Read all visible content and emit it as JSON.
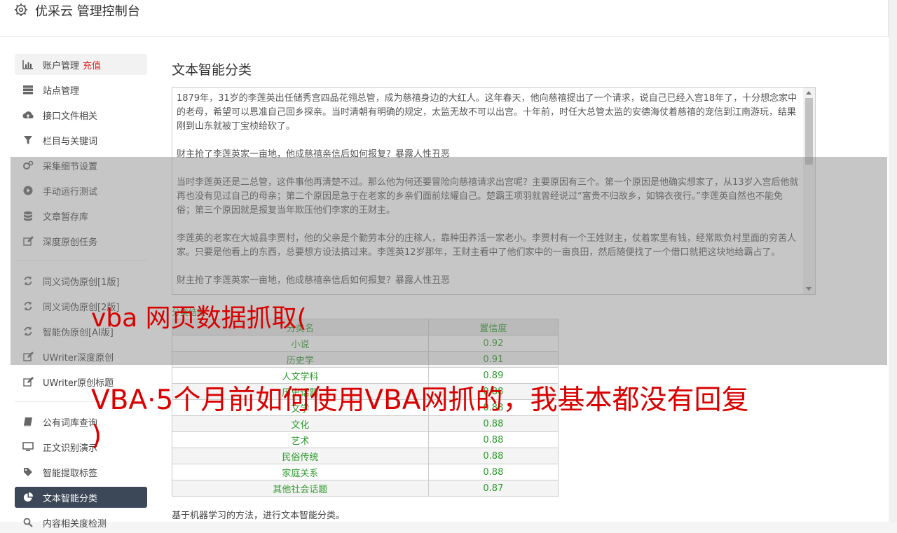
{
  "header": {
    "title": "优采云 管理控制台",
    "icon": "gear-icon"
  },
  "sidebar": {
    "items": [
      {
        "label": "账户管理",
        "badge": "充值",
        "icon": "bar-chart-icon"
      },
      {
        "label": "站点管理",
        "icon": "server-icon"
      },
      {
        "label": "接口文件相关",
        "icon": "cloud-upload-icon"
      },
      {
        "label": "栏目与关键词",
        "icon": "filter-icon"
      },
      {
        "label": "采集细节设置",
        "icon": "cogs-icon"
      },
      {
        "label": "手动运行测试",
        "icon": "play-circle-icon"
      },
      {
        "label": "文章暂存库",
        "icon": "database-icon"
      },
      {
        "label": "深度原创任务",
        "icon": "edit-icon"
      },
      {
        "label": "同义词伪原创[1版]",
        "icon": "refresh-icon"
      },
      {
        "label": "同义词伪原创[2版]",
        "icon": "refresh-icon"
      },
      {
        "label": "智能伪原创[AI版]",
        "icon": "refresh-icon"
      },
      {
        "label": "UWriter深度原创",
        "icon": "edit-icon"
      },
      {
        "label": "UWriter原创标题",
        "icon": "edit-icon"
      },
      {
        "label": "公有词库查询",
        "icon": "book-icon"
      },
      {
        "label": "正文识别演示",
        "icon": "desktop-icon"
      },
      {
        "label": "智能提取标签",
        "icon": "tag-icon"
      },
      {
        "label": "文本智能分类",
        "icon": "pie-chart-icon"
      },
      {
        "label": "内容相关度检测",
        "icon": "search-icon"
      }
    ]
  },
  "main": {
    "title": "文本智能分类",
    "text_paragraphs": [
      "1879年，31岁的李莲英出任储秀宫四品花翎总管，成为慈禧身边的大红人。这年春天，他向慈禧提出了一个请求，说自己已经入宫18年了，十分想念家中的老母，希望可以恩准自己回乡探亲。当时清朝有明确的规定，太监无故不可以出宫。十年前，时任大总管太监的安德海仗着慈禧的宠信到江南游玩，结果刚到山东就被丁宝桢给砍了。",
      "财主抢了李莲英家一亩地，他成慈禧亲信后如何报复？暴露人性丑恶",
      "当时李莲英还是二总管，这件事他再清楚不过。那么他为何还要冒险向慈禧请求出宫呢？主要原因有三个。第一个原因是他确实想家了，从13岁入宫后他就再也没有见过自己的母亲；第二个原因是急于在老家的乡亲们面前炫耀自己。楚霸王项羽就曾经说过“富贵不归故乡，如锦衣夜行。”李莲英自然也不能免俗；第三个原因就是报复当年欺压他们李家的王财主。",
      "李莲英的老家在大城县李贾村，他的父亲是个勤劳本分的庄稼人，靠种田养活一家老小。李贾村有一个王姓财主，仗着家里有钱，经常欺负村里面的穷苦人家。只要是他看上的东西，总要想方设法搞过来。李莲英12岁那年，王财主看中了他们家中的一亩良田，然后随便找了一个借口就把这块地给霸占了。",
      "财主抢了李莲英家一亩地，他成慈禧亲信后如何报复？暴露人性丑恶"
    ],
    "result_label": "分类结果",
    "table": {
      "headers": [
        "分类名",
        "置信度"
      ],
      "rows": [
        [
          "小说",
          "0.92"
        ],
        [
          "历史学",
          "0.91"
        ],
        [
          "人文学科",
          "0.89"
        ],
        [
          "历史话题",
          "0.88"
        ],
        [
          "文学",
          "0.88"
        ],
        [
          "文化",
          "0.88"
        ],
        [
          "艺术",
          "0.88"
        ],
        [
          "民俗传统",
          "0.88"
        ],
        [
          "家庭关系",
          "0.88"
        ],
        [
          "其他社会话题",
          "0.87"
        ]
      ]
    },
    "description": "基于机器学习的方法，进行文本智能分类。"
  },
  "overlay": {
    "title": "vba 网页数据抓取(",
    "line1": "VBA·5个月前如何使用VBA网抓的，我基本都没有回复",
    "line2": ")"
  },
  "colors": {
    "accent_active": "#3c4757",
    "badge_red": "#e02020",
    "table_green": "#2e9a2e",
    "overlay_red": "#d90000"
  }
}
